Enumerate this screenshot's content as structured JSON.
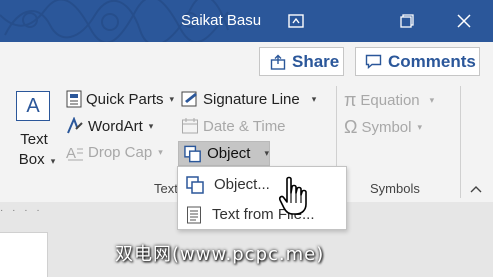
{
  "titlebar": {
    "user_name": "Saikat Basu",
    "icons": [
      "ribbon-display-options-icon",
      "restore-icon",
      "close-icon"
    ],
    "color": "#2b579a"
  },
  "header": {
    "share_label": "Share",
    "comments_label": "Comments"
  },
  "ribbon": {
    "text_box_label_line1": "Text",
    "text_box_label_line2": "Box",
    "quick_parts_label": "Quick Parts",
    "wordart_label": "WordArt",
    "drop_cap_label": "Drop Cap",
    "signature_line_label": "Signature Line",
    "date_time_label": "Date & Time",
    "object_label": "Object",
    "equation_label": "Equation",
    "symbol_label": "Symbol",
    "text_group_label": "Text",
    "symbols_group_label": "Symbols"
  },
  "dropdown": {
    "items": [
      {
        "label": "Object...",
        "icon": "object-icon"
      },
      {
        "label": "Text from File...",
        "icon": "text-file-icon"
      }
    ]
  },
  "watermark": "双电网(www.pcpc.me)"
}
